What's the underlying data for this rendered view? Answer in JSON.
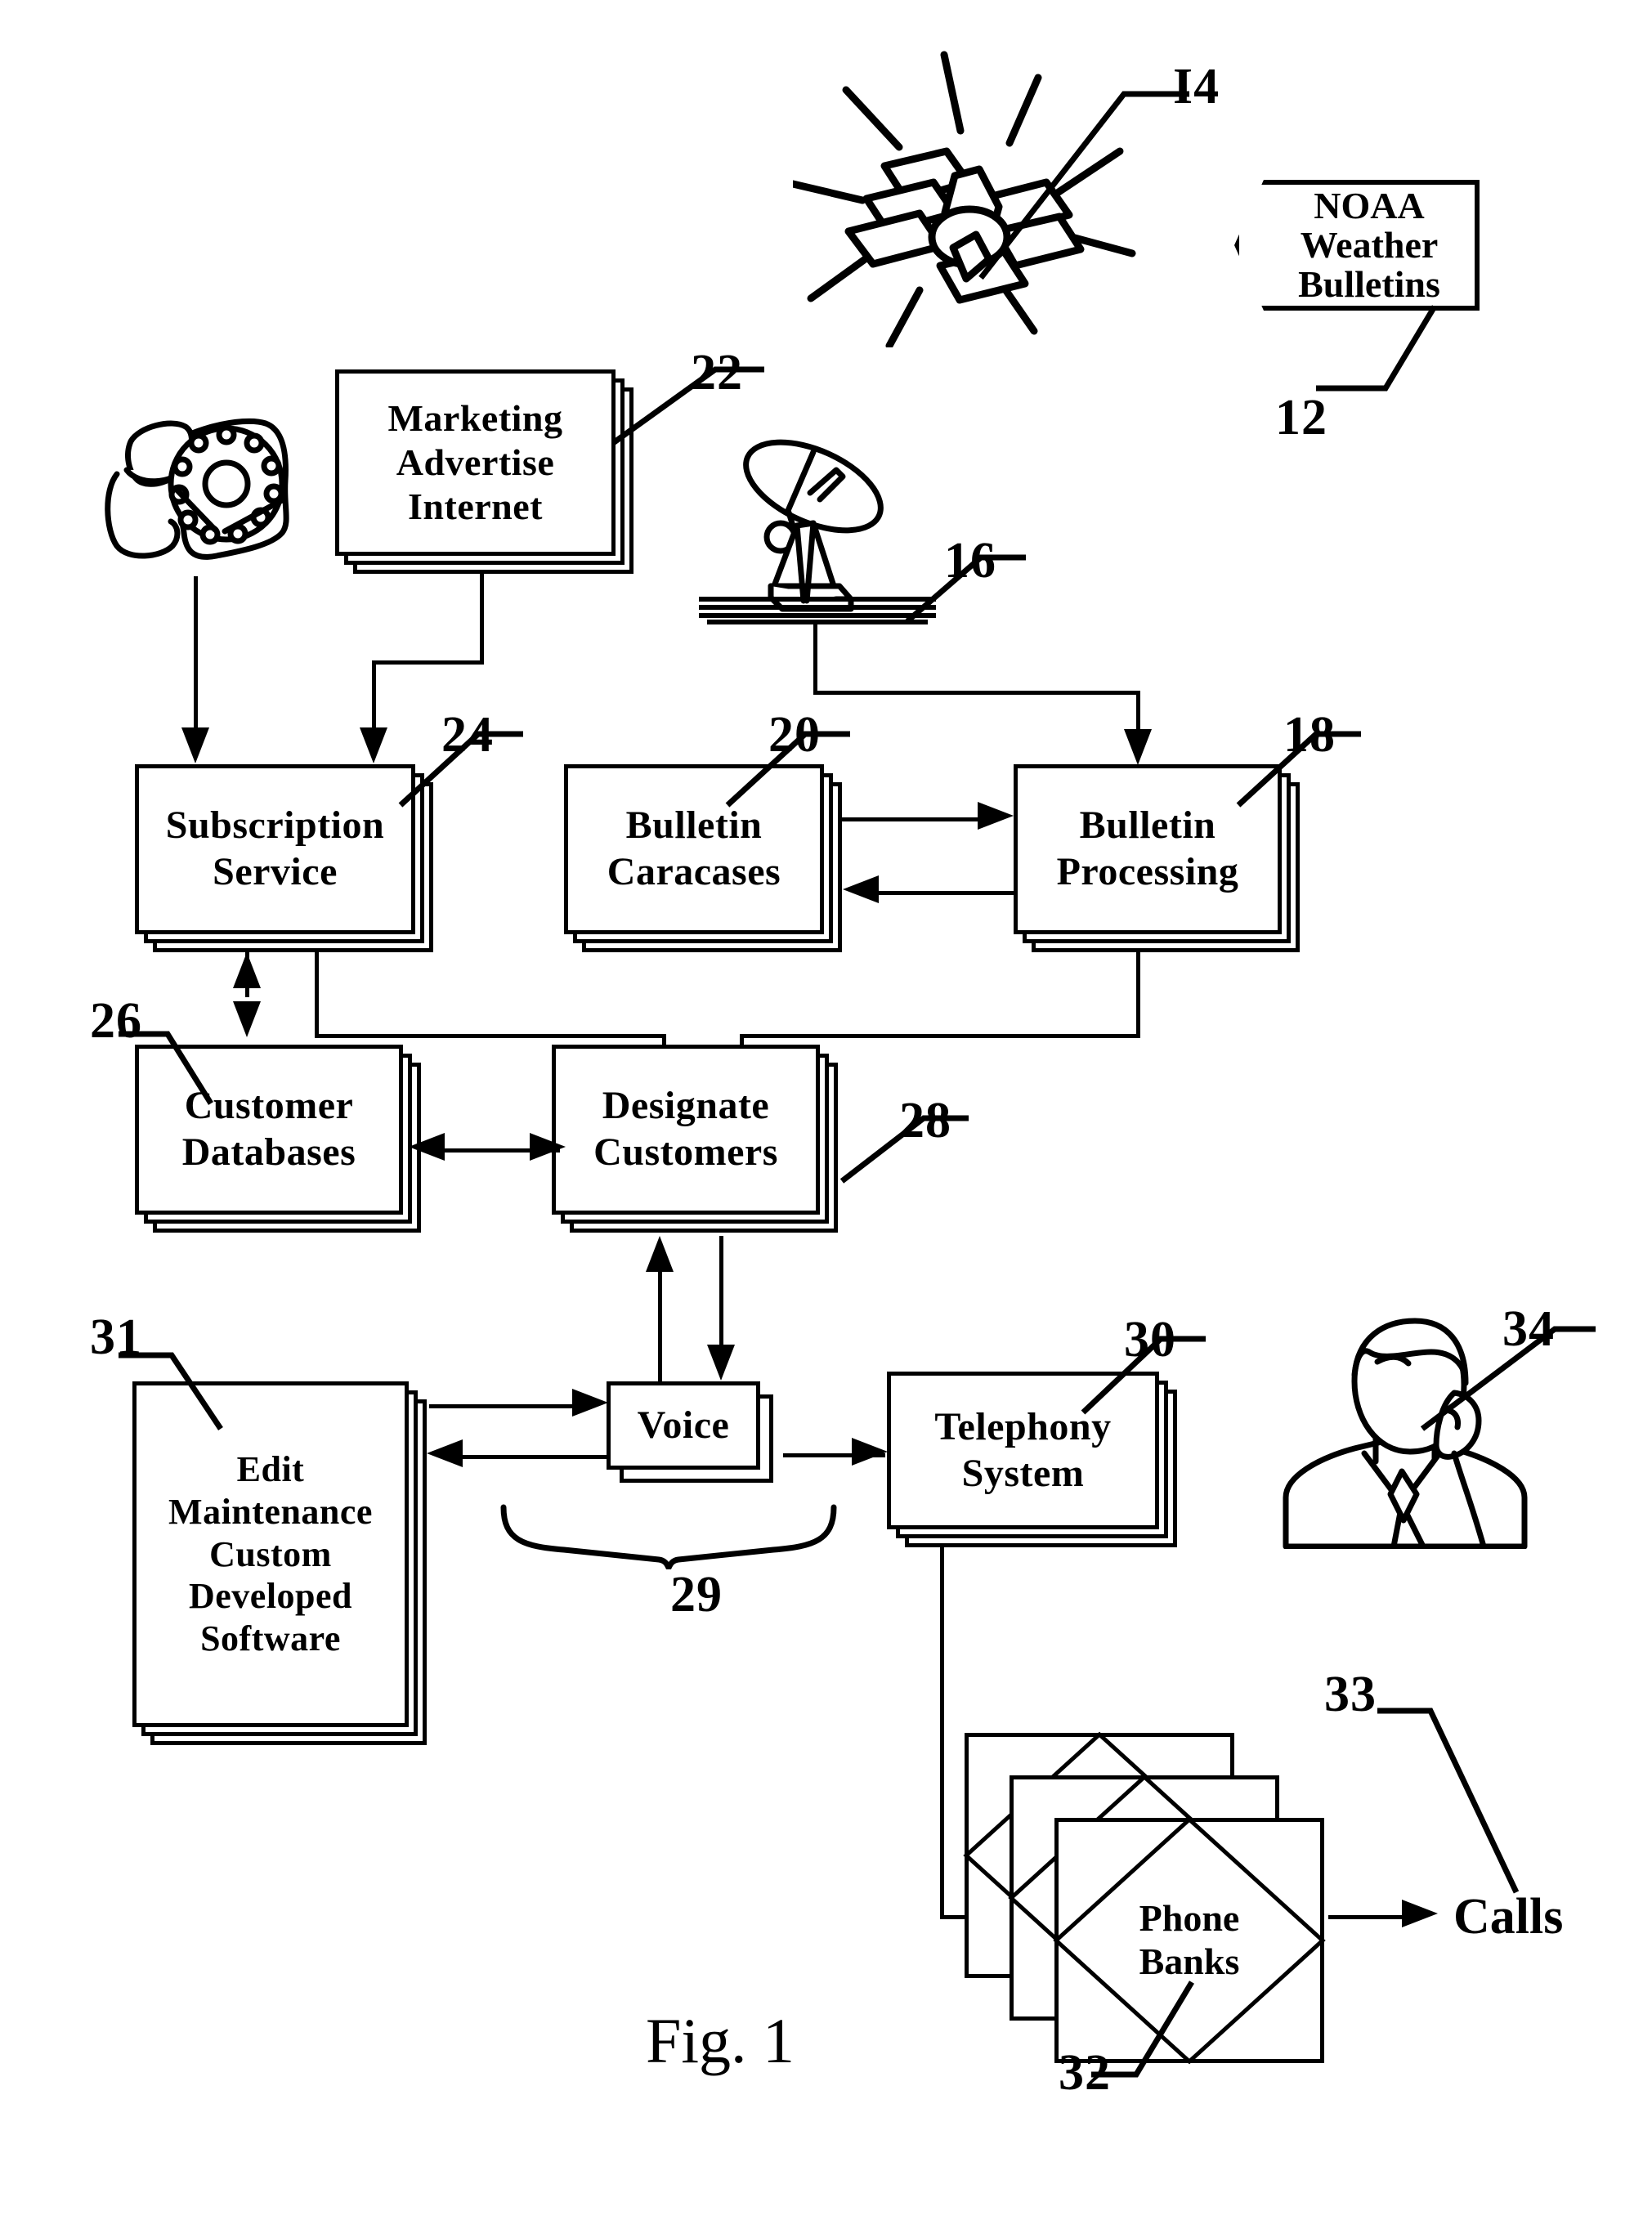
{
  "figure": {
    "caption": "Fig. 1",
    "title_note": "Weather bulletin telephony notification system block diagram"
  },
  "badges": {
    "noaa": {
      "line1": "NOAA",
      "line2": "Weather",
      "line3": "Bulletins",
      "ref": "12"
    }
  },
  "icons": {
    "satellite": {
      "name": "satellite-icon",
      "ref": "I4"
    },
    "satellite_dish": {
      "name": "satellite-dish-icon",
      "ref": "16"
    },
    "telephone": {
      "name": "rotary-telephone-icon",
      "ref": ""
    },
    "person_on_phone": {
      "name": "person-on-phone-icon",
      "ref": "34"
    }
  },
  "blocks": [
    {
      "id": "marketing",
      "ref": "22",
      "lines": [
        "Marketing",
        "Advertise",
        "Internet"
      ]
    },
    {
      "id": "subscription",
      "ref": "24",
      "lines": [
        "Subscription",
        "Service"
      ]
    },
    {
      "id": "caracases",
      "ref": "20",
      "lines": [
        "Bulletin",
        "Caracases"
      ]
    },
    {
      "id": "processing",
      "ref": "18",
      "lines": [
        "Bulletin",
        "Processing"
      ]
    },
    {
      "id": "customerdb",
      "ref": "26",
      "lines": [
        "Customer",
        "Databases"
      ]
    },
    {
      "id": "designate",
      "ref": "28",
      "lines": [
        "Designate",
        "Customers"
      ]
    },
    {
      "id": "editmaint",
      "ref": "31",
      "lines": [
        "Edit",
        "Maintenance",
        "Custom",
        "Developed",
        "Software"
      ]
    },
    {
      "id": "voice",
      "ref": "",
      "lines": [
        "Voice"
      ]
    },
    {
      "id": "telephony",
      "ref": "30",
      "lines": [
        "Telephony",
        "System"
      ]
    },
    {
      "id": "phonebanks",
      "ref": "32",
      "lines": [
        "Phone",
        "Banks"
      ]
    }
  ],
  "brace": {
    "ref": "29"
  },
  "output": {
    "label": "Calls",
    "ref": "33"
  },
  "colors": {
    "ink": "#000000",
    "paper": "#ffffff"
  }
}
